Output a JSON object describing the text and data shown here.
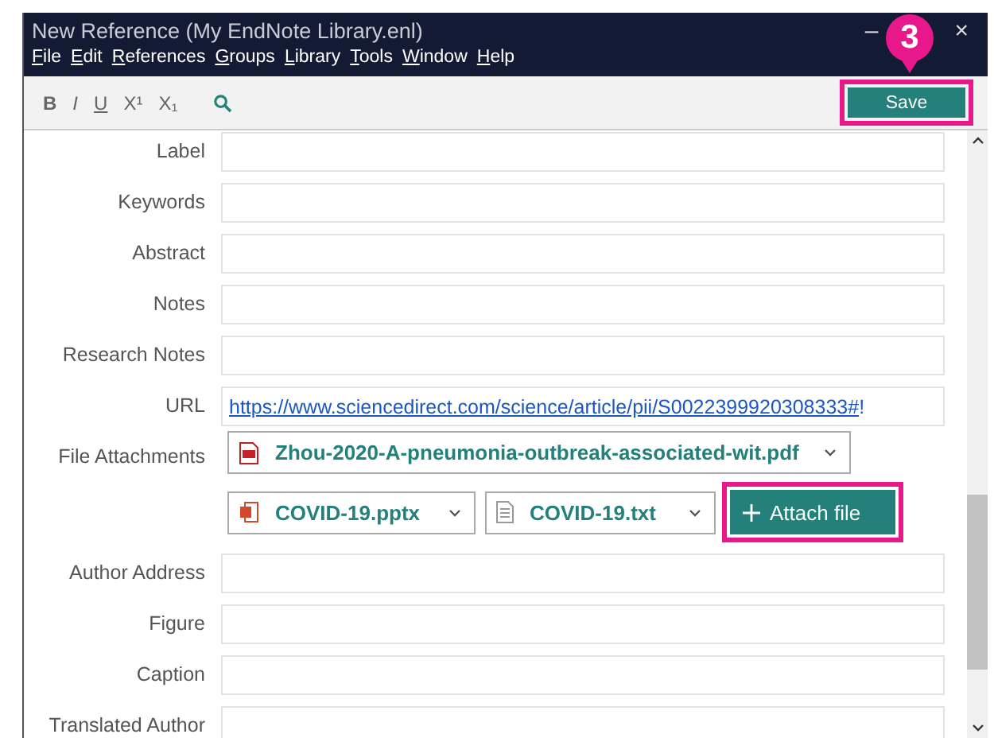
{
  "window": {
    "title": "New Reference (My EndNote Library.enl)",
    "minimize": "–",
    "close": "×"
  },
  "menu": [
    "File",
    "Edit",
    "References",
    "Groups",
    "Library",
    "Tools",
    "Window",
    "Help"
  ],
  "toolbar": {
    "format_buttons": [
      {
        "label": "B",
        "kind": "bold"
      },
      {
        "label": "I",
        "kind": "italic"
      },
      {
        "label": "U",
        "kind": "underline"
      },
      {
        "label": "X¹",
        "kind": "plain"
      },
      {
        "label": "X₁",
        "kind": "plain"
      }
    ],
    "save": "Save"
  },
  "callout": "3",
  "fields": [
    {
      "label": "Label",
      "kind": "text"
    },
    {
      "label": "Keywords",
      "kind": "text"
    },
    {
      "label": "Abstract",
      "kind": "text"
    },
    {
      "label": "Notes",
      "kind": "text"
    },
    {
      "label": "Research Notes",
      "kind": "text"
    },
    {
      "label": "URL",
      "kind": "url",
      "link": "https://www.sciencedirect.com/science/article/pii/S0022399920308333#",
      "suffix": "!"
    },
    {
      "label": "File Attachments",
      "kind": "attachments",
      "files": [
        {
          "name": "Zhou-2020-A-pneumonia-outbreak-associated-wit.pdf",
          "kind": "pdf"
        },
        {
          "name": "COVID-19.pptx",
          "kind": "pptx"
        },
        {
          "name": "COVID-19.txt",
          "kind": "txt"
        }
      ],
      "button": "Attach file"
    },
    {
      "label": "Author Address",
      "kind": "text"
    },
    {
      "label": "Figure",
      "kind": "text"
    },
    {
      "label": "Caption",
      "kind": "text"
    },
    {
      "label": "Translated Author",
      "kind": "text"
    }
  ]
}
